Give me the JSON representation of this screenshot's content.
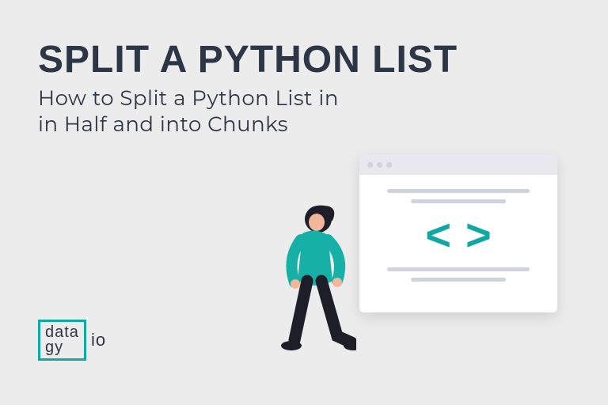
{
  "title": "SPLIT A PYTHON LIST",
  "subtitle_line1": "How to Split a Python List in",
  "subtitle_line2": "in Half and into Chunks",
  "logo": {
    "box_line1": "data",
    "box_line2": "gy",
    "suffix": "io"
  },
  "illustration": {
    "bracket_left": "<",
    "bracket_right": ">"
  },
  "colors": {
    "accent": "#0fa8a3",
    "text": "#2d3646",
    "bg": "#edecec"
  }
}
